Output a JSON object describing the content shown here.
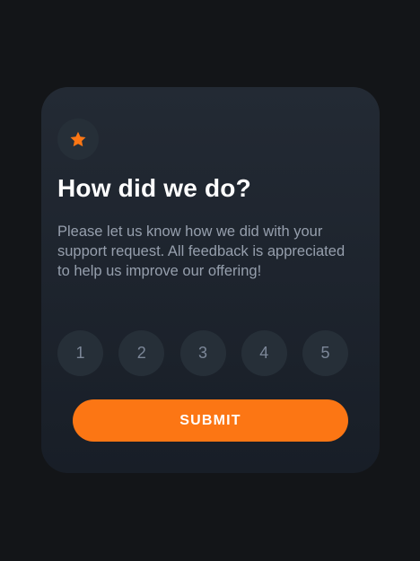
{
  "card": {
    "icon": "star-icon",
    "title": "How did we do?",
    "description": "Please let us know how we did with your support request. All feedback is appreciated to help us improve our offering!",
    "ratings": [
      "1",
      "2",
      "3",
      "4",
      "5"
    ],
    "submit_label": "SUBMIT"
  },
  "colors": {
    "background": "#131518",
    "card_top": "#232a34",
    "card_bottom": "#181e27",
    "circle": "#262f38",
    "accent": "#fc7614",
    "title": "#ffffff",
    "body_text": "#969fad",
    "rating_text": "#7c8798"
  }
}
